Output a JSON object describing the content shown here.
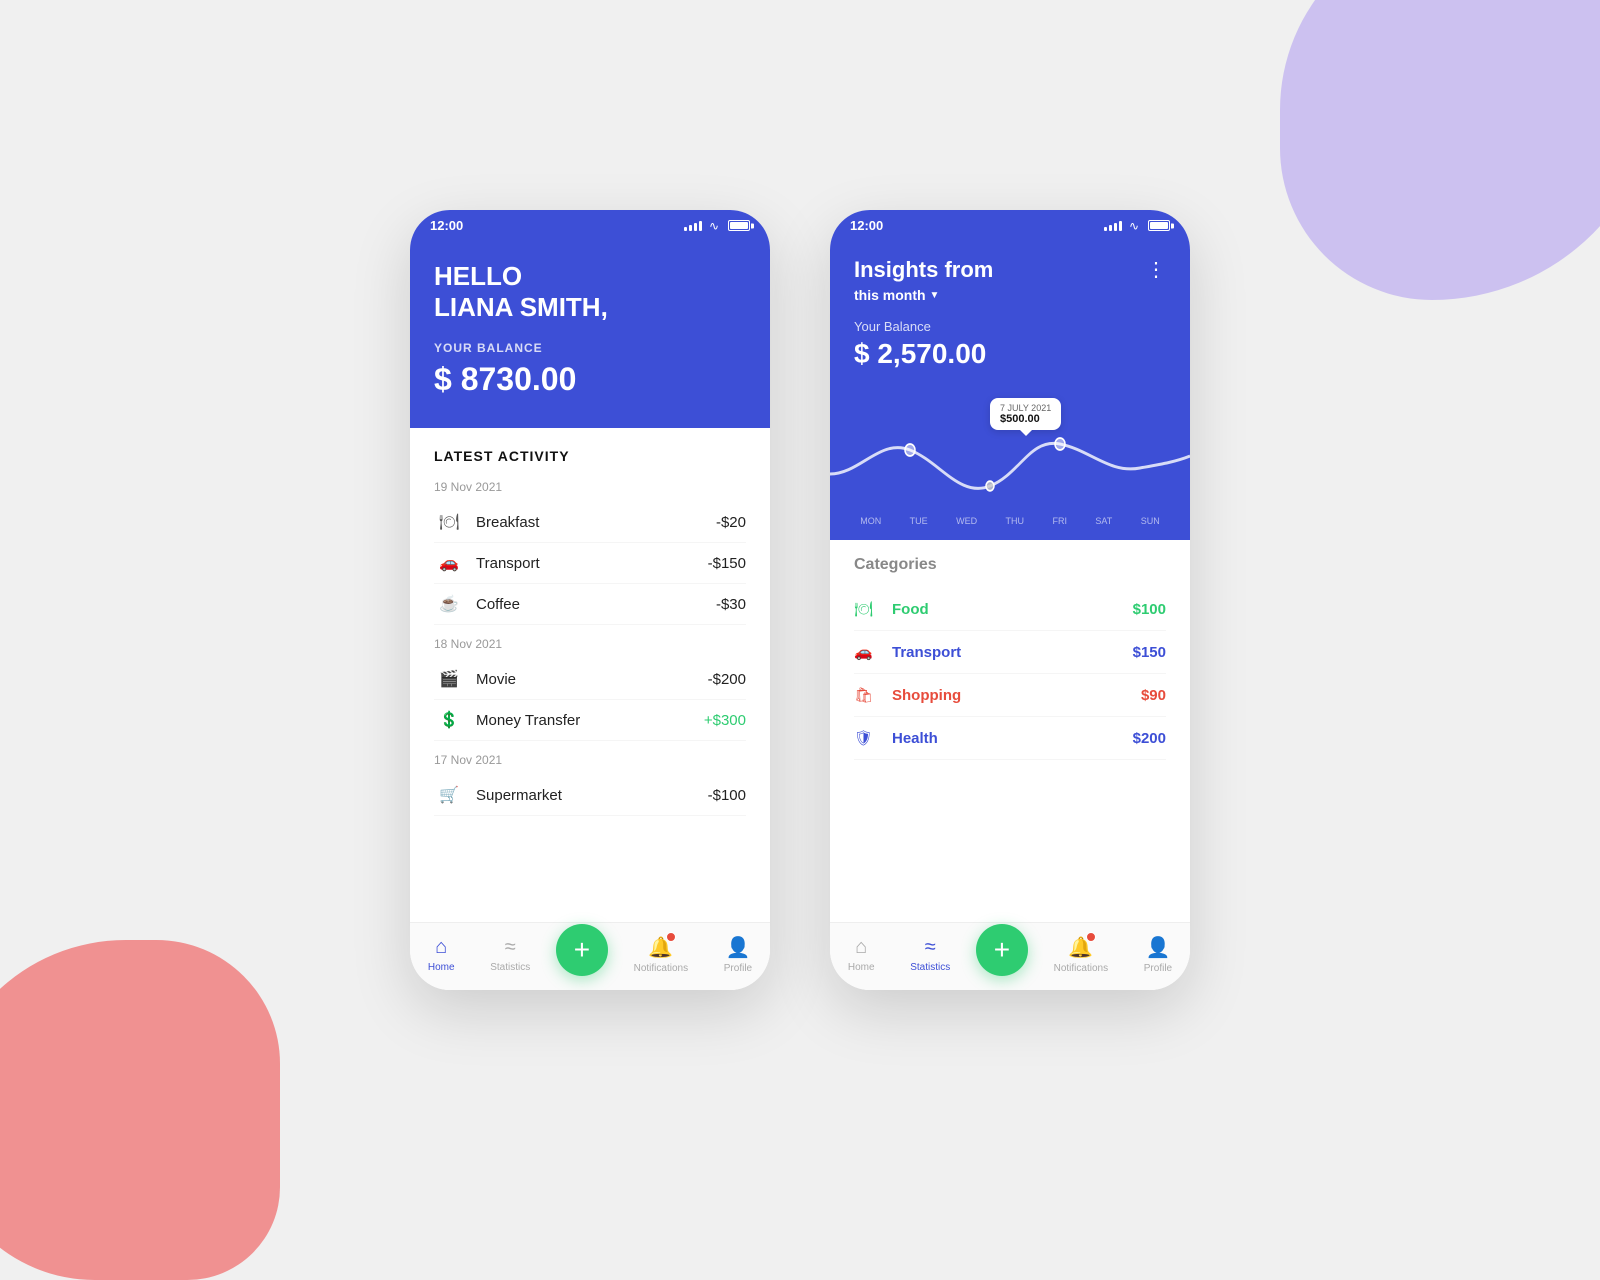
{
  "background": {
    "blob_purple_color": "#c5b8f0",
    "blob_red_color": "#f08080"
  },
  "phone1": {
    "status": {
      "time": "12:00"
    },
    "header": {
      "greeting_line1": "HELLO",
      "greeting_line2": "LIANA SMITH,",
      "balance_label": "YOUR BALANCE",
      "balance_amount": "$ 8730.00"
    },
    "activity": {
      "section_title": "LATEST ACTIVITY",
      "groups": [
        {
          "date": "19 Nov 2021",
          "items": [
            {
              "icon": "🍽",
              "name": "Breakfast",
              "amount": "-$20"
            },
            {
              "icon": "🚗",
              "name": "Transport",
              "amount": "-$150"
            },
            {
              "icon": "☕",
              "name": "Coffee",
              "amount": "-$30"
            }
          ]
        },
        {
          "date": "18 Nov 2021",
          "items": [
            {
              "icon": "🎬",
              "name": "Movie",
              "amount": "-$200"
            },
            {
              "icon": "💲",
              "name": "Money Transfer",
              "amount": "+$300",
              "positive": true
            }
          ]
        },
        {
          "date": "17 Nov 2021",
          "items": [
            {
              "icon": "🛒",
              "name": "Supermarket",
              "amount": "-$100"
            }
          ]
        }
      ]
    },
    "nav": {
      "items": [
        {
          "label": "Home",
          "active": true
        },
        {
          "label": "Statistics",
          "active": false
        },
        {
          "label": "",
          "add_button": true
        },
        {
          "label": "Notifications",
          "active": false,
          "badge": true
        },
        {
          "label": "Profile",
          "active": false
        }
      ]
    }
  },
  "phone2": {
    "status": {
      "time": "12:00"
    },
    "header": {
      "title_line1": "Insights from",
      "title_line2": "this month",
      "balance_label": "Your Balance",
      "balance_amount": "$ 2,570.00"
    },
    "chart": {
      "tooltip_date": "7 JULY 2021",
      "tooltip_value": "$500.00",
      "days": [
        "MON",
        "TUE",
        "WED",
        "THU",
        "FRI",
        "SAT",
        "SUN"
      ]
    },
    "categories": {
      "title": "Categories",
      "items": [
        {
          "icon": "🍽",
          "name": "Food",
          "amount": "$100",
          "color": "green"
        },
        {
          "icon": "🚗",
          "name": "Transport",
          "amount": "$150",
          "color": "blue"
        },
        {
          "icon": "🛍",
          "name": "Shopping",
          "amount": "$90",
          "color": "red"
        },
        {
          "icon": "🛡",
          "name": "Health",
          "amount": "$200",
          "color": "blue"
        }
      ]
    },
    "nav": {
      "items": [
        {
          "label": "Home",
          "active": false
        },
        {
          "label": "Statistics",
          "active": true
        },
        {
          "label": "",
          "add_button": true
        },
        {
          "label": "Notifications",
          "active": false,
          "badge": true
        },
        {
          "label": "Profile",
          "active": false
        }
      ]
    }
  }
}
